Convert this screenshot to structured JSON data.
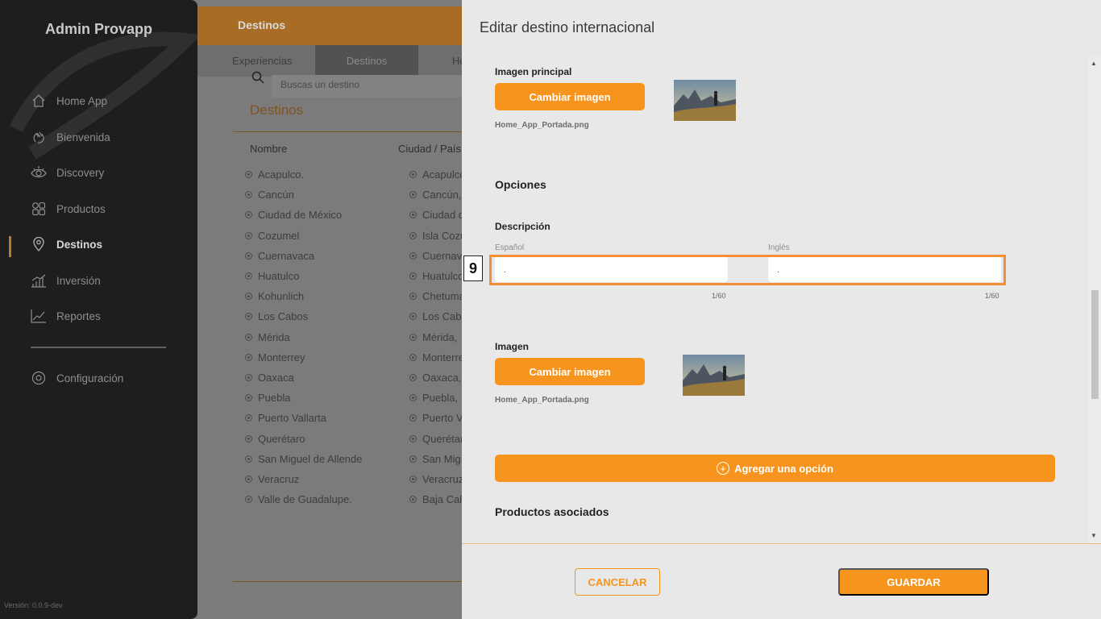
{
  "sidebar": {
    "title": "Admin Provapp",
    "items": [
      {
        "label": "Home App",
        "icon": "home-icon"
      },
      {
        "label": "Bienvenida",
        "icon": "wave-hand-icon"
      },
      {
        "label": "Discovery",
        "icon": "eye-icon"
      },
      {
        "label": "Productos",
        "icon": "grid-icon"
      },
      {
        "label": "Destinos",
        "icon": "map-pin-icon",
        "active": true
      },
      {
        "label": "Inversión",
        "icon": "bar-chart-icon"
      },
      {
        "label": "Reportes",
        "icon": "line-chart-icon"
      }
    ],
    "settings_label": "Configuración",
    "version": "Versión: 0.0.9-dev"
  },
  "background": {
    "header_title": "Destinos",
    "tabs": [
      "Experiencias",
      "Destinos",
      "Ho"
    ],
    "search_placeholder": "Buscas un destino",
    "section_title": "Destinos",
    "col_name": "Nombre",
    "col_city": "Ciudad / País",
    "rows": [
      {
        "name": "Acapulco.",
        "city": "Acapulco"
      },
      {
        "name": "Cancún",
        "city": "Cancún,"
      },
      {
        "name": "Ciudad de México",
        "city": "Ciudad d"
      },
      {
        "name": "Cozumel",
        "city": "Isla Cozu"
      },
      {
        "name": "Cuernavaca",
        "city": "Cuernava"
      },
      {
        "name": "Huatulco",
        "city": "Huatulco"
      },
      {
        "name": "Kohunlich",
        "city": "Chetuma"
      },
      {
        "name": "Los Cabos",
        "city": "Los Cab"
      },
      {
        "name": "Mérida",
        "city": "Mérida,"
      },
      {
        "name": "Monterrey",
        "city": "Monterre"
      },
      {
        "name": "Oaxaca",
        "city": "Oaxaca,"
      },
      {
        "name": "Puebla",
        "city": "Puebla,"
      },
      {
        "name": "Puerto Vallarta",
        "city": "Puerto V"
      },
      {
        "name": "Querétaro",
        "city": "Querétar"
      },
      {
        "name": "San Miguel de Allende",
        "city": "San Mig"
      },
      {
        "name": "Veracruz",
        "city": "Veracruz"
      },
      {
        "name": "Valle de Guadalupe.",
        "city": "Baja Cal"
      }
    ]
  },
  "modal": {
    "title": "Editar destino internacional",
    "main_image": {
      "label": "Imagen principal",
      "button": "Cambiar imagen",
      "filename": "Home_App_Portada.png"
    },
    "options_heading": "Opciones",
    "description": {
      "label": "Descripción",
      "es_label": "Español",
      "en_label": "Inglés",
      "es_value": ".",
      "en_value": ".",
      "es_counter": "1/60",
      "en_counter": "1/60"
    },
    "option_image": {
      "label": "Imagen",
      "button": "Cambiar imagen",
      "filename": "Home_App_Portada.png"
    },
    "add_option": "Agregar una opción",
    "products_heading": "Productos asociados",
    "cancel": "CANCELAR",
    "save": "GUARDAR"
  },
  "annotation": {
    "marker": "9"
  },
  "colors": {
    "accent": "#f7941d",
    "sidebar_bg": "#1e1e1e",
    "modal_bg": "#e8e8e8"
  }
}
